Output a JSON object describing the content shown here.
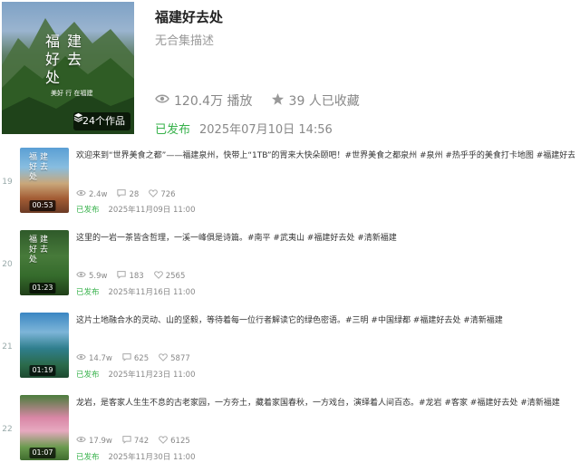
{
  "collection": {
    "cover_title": "福建好去处",
    "cover_subtitle": "美好 行 在福建",
    "works_badge": "24个作品",
    "title": "福建好去处",
    "description": "无合集描述",
    "plays": "120.4万 播放",
    "favorites": "39 人已收藏",
    "status": "已发布",
    "date": "2025年07月10日 14:56"
  },
  "items": [
    {
      "index": "19",
      "thumb_text": "福建好去处",
      "duration": "00:53",
      "desc": "欢迎来到“世界美食之都”——福建泉州，快带上“1TB”的胃来大快朵颐吧！#世界美食之都泉州 #泉州 #热乎乎的美食打卡地图 #福建好去处 #",
      "views": "2.4w",
      "comments": "28",
      "likes": "726",
      "status": "已发布",
      "date": "2025年11月09日 11:00"
    },
    {
      "index": "20",
      "thumb_text": "福建好去处",
      "duration": "01:23",
      "desc": "这里的一岩一茶皆含哲理，一溪一峰俱是诗篇。#南平 #武夷山 #福建好去处 #清新福建",
      "views": "5.9w",
      "comments": "183",
      "likes": "2565",
      "status": "已发布",
      "date": "2025年11月16日 11:00"
    },
    {
      "index": "21",
      "thumb_text": "",
      "duration": "01:19",
      "desc": "这片土地融合水的灵动、山的坚毅，等待着每一位行者解读它的绿色密语。#三明 #中国绿都 #福建好去处 #清新福建",
      "views": "14.7w",
      "comments": "625",
      "likes": "5877",
      "status": "已发布",
      "date": "2025年11月23日 11:00"
    },
    {
      "index": "22",
      "thumb_text": "",
      "duration": "01:07",
      "desc": "龙岩，是客家人生生不息的古老家园，一方夯土，藏着家国春秋，一方戏台，演绎着人间百态。#龙岩 #客家 #福建好去处 #清新福建",
      "views": "17.9w",
      "comments": "742",
      "likes": "6125",
      "status": "已发布",
      "date": "2025年11月30日 11:00"
    }
  ]
}
